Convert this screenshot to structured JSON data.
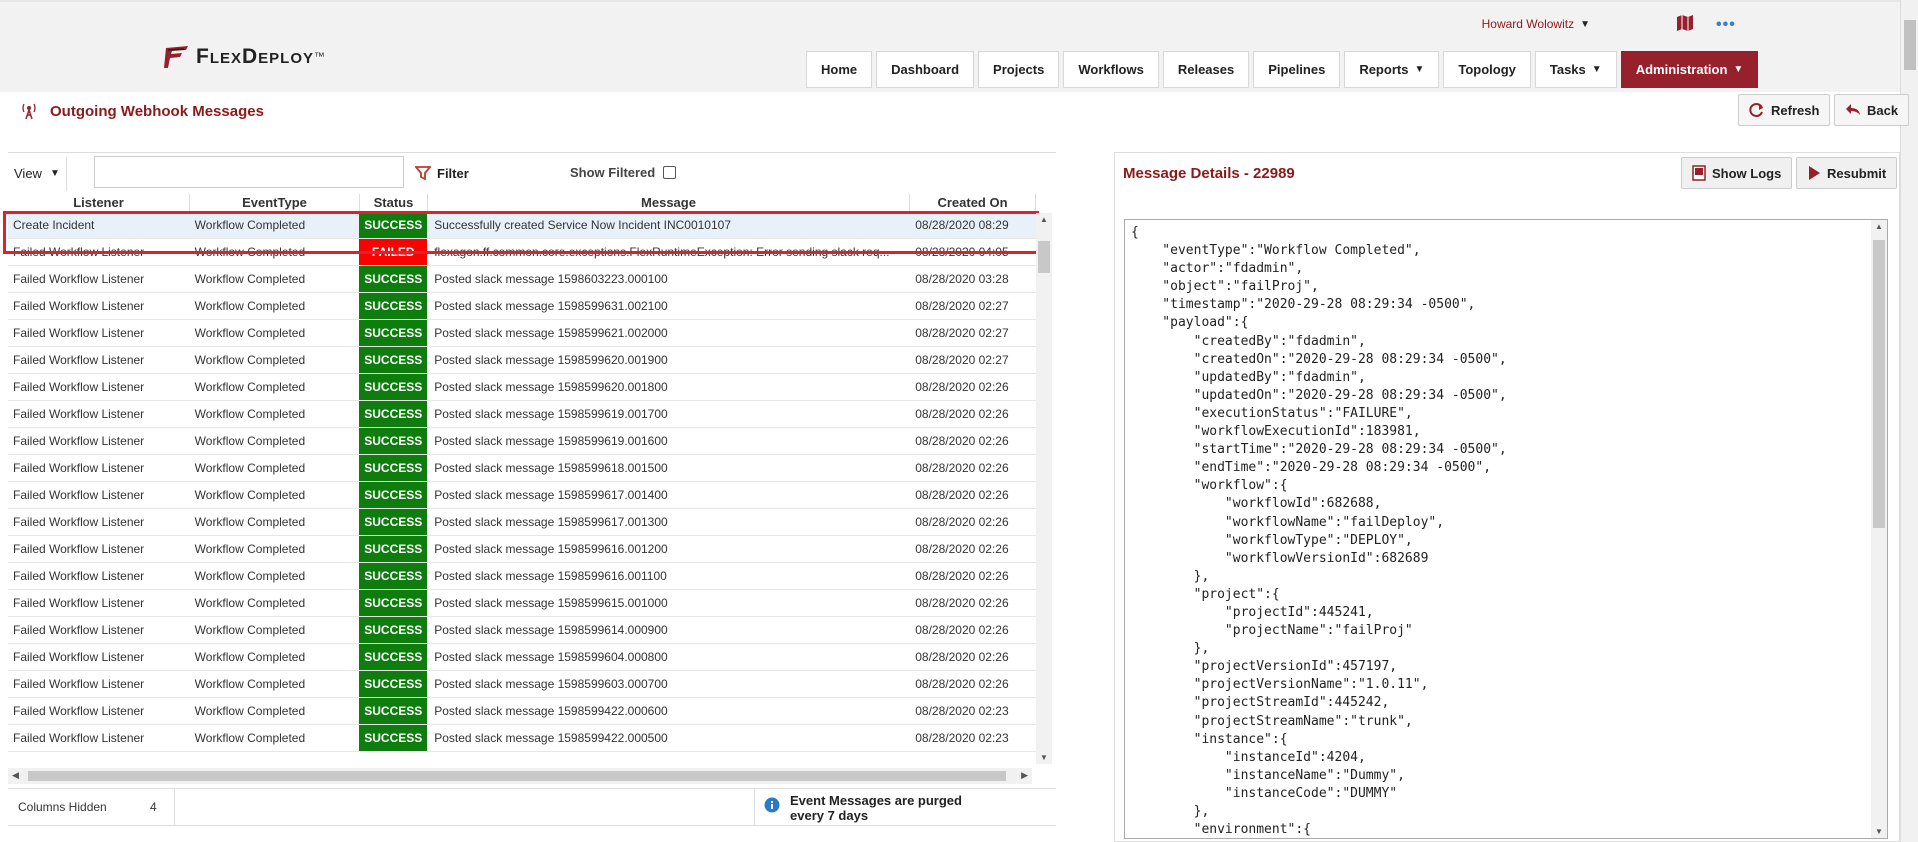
{
  "header": {
    "logo_text": "FlexDeploy",
    "logo_tm": "™",
    "user_name": "Howard Wolowitz",
    "more_dots": "•••",
    "nav": [
      {
        "label": "Home",
        "dropdown": false
      },
      {
        "label": "Dashboard",
        "dropdown": false
      },
      {
        "label": "Projects",
        "dropdown": false
      },
      {
        "label": "Workflows",
        "dropdown": false
      },
      {
        "label": "Releases",
        "dropdown": false
      },
      {
        "label": "Pipelines",
        "dropdown": false
      },
      {
        "label": "Reports",
        "dropdown": true
      },
      {
        "label": "Topology",
        "dropdown": false
      },
      {
        "label": "Tasks",
        "dropdown": true
      },
      {
        "label": "Administration",
        "dropdown": true,
        "active": true
      }
    ]
  },
  "page": {
    "title": "Outgoing Webhook Messages",
    "refresh_label": "Refresh",
    "back_label": "Back"
  },
  "toolbar": {
    "view_label": "View",
    "search_value": "",
    "filter_label": "Filter",
    "show_filtered_label": "Show Filtered",
    "show_filtered_checked": false
  },
  "table": {
    "columns": [
      "Listener",
      "EventType",
      "Status",
      "Message",
      "Created On"
    ],
    "rows": [
      {
        "listener": "Create Incident",
        "event": "Workflow Completed",
        "status": "SUCCESS",
        "message": "Successfully created Service Now Incident INC0010107",
        "created": "08/28/2020 08:29",
        "selected": true
      },
      {
        "listener": "Failed Workflow Listener",
        "event": "Workflow Completed",
        "status": "FAILED",
        "message": "flexagon.ff.common.core.exceptions.FlexRuntimeException: Error sending slack req...",
        "created": "08/28/2020 04:05"
      },
      {
        "listener": "Failed Workflow Listener",
        "event": "Workflow Completed",
        "status": "SUCCESS",
        "message": "Posted slack message 1598603223.000100",
        "created": "08/28/2020 03:28"
      },
      {
        "listener": "Failed Workflow Listener",
        "event": "Workflow Completed",
        "status": "SUCCESS",
        "message": "Posted slack message 1598599631.002100",
        "created": "08/28/2020 02:27"
      },
      {
        "listener": "Failed Workflow Listener",
        "event": "Workflow Completed",
        "status": "SUCCESS",
        "message": "Posted slack message 1598599621.002000",
        "created": "08/28/2020 02:27"
      },
      {
        "listener": "Failed Workflow Listener",
        "event": "Workflow Completed",
        "status": "SUCCESS",
        "message": "Posted slack message 1598599620.001900",
        "created": "08/28/2020 02:27"
      },
      {
        "listener": "Failed Workflow Listener",
        "event": "Workflow Completed",
        "status": "SUCCESS",
        "message": "Posted slack message 1598599620.001800",
        "created": "08/28/2020 02:26"
      },
      {
        "listener": "Failed Workflow Listener",
        "event": "Workflow Completed",
        "status": "SUCCESS",
        "message": "Posted slack message 1598599619.001700",
        "created": "08/28/2020 02:26"
      },
      {
        "listener": "Failed Workflow Listener",
        "event": "Workflow Completed",
        "status": "SUCCESS",
        "message": "Posted slack message 1598599619.001600",
        "created": "08/28/2020 02:26"
      },
      {
        "listener": "Failed Workflow Listener",
        "event": "Workflow Completed",
        "status": "SUCCESS",
        "message": "Posted slack message 1598599618.001500",
        "created": "08/28/2020 02:26"
      },
      {
        "listener": "Failed Workflow Listener",
        "event": "Workflow Completed",
        "status": "SUCCESS",
        "message": "Posted slack message 1598599617.001400",
        "created": "08/28/2020 02:26"
      },
      {
        "listener": "Failed Workflow Listener",
        "event": "Workflow Completed",
        "status": "SUCCESS",
        "message": "Posted slack message 1598599617.001300",
        "created": "08/28/2020 02:26"
      },
      {
        "listener": "Failed Workflow Listener",
        "event": "Workflow Completed",
        "status": "SUCCESS",
        "message": "Posted slack message 1598599616.001200",
        "created": "08/28/2020 02:26"
      },
      {
        "listener": "Failed Workflow Listener",
        "event": "Workflow Completed",
        "status": "SUCCESS",
        "message": "Posted slack message 1598599616.001100",
        "created": "08/28/2020 02:26"
      },
      {
        "listener": "Failed Workflow Listener",
        "event": "Workflow Completed",
        "status": "SUCCESS",
        "message": "Posted slack message 1598599615.001000",
        "created": "08/28/2020 02:26"
      },
      {
        "listener": "Failed Workflow Listener",
        "event": "Workflow Completed",
        "status": "SUCCESS",
        "message": "Posted slack message 1598599614.000900",
        "created": "08/28/2020 02:26"
      },
      {
        "listener": "Failed Workflow Listener",
        "event": "Workflow Completed",
        "status": "SUCCESS",
        "message": "Posted slack message 1598599604.000800",
        "created": "08/28/2020 02:26"
      },
      {
        "listener": "Failed Workflow Listener",
        "event": "Workflow Completed",
        "status": "SUCCESS",
        "message": "Posted slack message 1598599603.000700",
        "created": "08/28/2020 02:26"
      },
      {
        "listener": "Failed Workflow Listener",
        "event": "Workflow Completed",
        "status": "SUCCESS",
        "message": "Posted slack message 1598599422.000600",
        "created": "08/28/2020 02:23"
      },
      {
        "listener": "Failed Workflow Listener",
        "event": "Workflow Completed",
        "status": "SUCCESS",
        "message": "Posted slack message 1598599422.000500",
        "created": "08/28/2020 02:23"
      }
    ]
  },
  "footer": {
    "columns_hidden_label": "Columns Hidden",
    "columns_hidden_count": "4",
    "purge_notice": "Event Messages are purged every 7 days"
  },
  "details": {
    "title": "Message Details - 22989",
    "show_logs_label": "Show Logs",
    "resubmit_label": "Resubmit",
    "json_lines": [
      "{",
      "    \"eventType\":\"Workflow Completed\",",
      "    \"actor\":\"fdadmin\",",
      "    \"object\":\"failProj\",",
      "    \"timestamp\":\"2020-29-28 08:29:34 -0500\",",
      "    \"payload\":{",
      "        \"createdBy\":\"fdadmin\",",
      "        \"createdOn\":\"2020-29-28 08:29:34 -0500\",",
      "        \"updatedBy\":\"fdadmin\",",
      "        \"updatedOn\":\"2020-29-28 08:29:34 -0500\",",
      "        \"executionStatus\":\"FAILURE\",",
      "        \"workflowExecutionId\":183981,",
      "        \"startTime\":\"2020-29-28 08:29:34 -0500\",",
      "        \"endTime\":\"2020-29-28 08:29:34 -0500\",",
      "        \"workflow\":{",
      "            \"workflowId\":682688,",
      "            \"workflowName\":\"failDeploy\",",
      "            \"workflowType\":\"DEPLOY\",",
      "            \"workflowVersionId\":682689",
      "        },",
      "        \"project\":{",
      "            \"projectId\":445241,",
      "            \"projectName\":\"failProj\"",
      "        },",
      "        \"projectVersionId\":457197,",
      "        \"projectVersionName\":\"1.0.11\",",
      "        \"projectStreamId\":445242,",
      "        \"projectStreamName\":\"trunk\",",
      "        \"instance\":{",
      "            \"instanceId\":4204,",
      "            \"instanceName\":\"Dummy\",",
      "            \"instanceCode\":\"DUMMY\"",
      "        },",
      "        \"environment\":{"
    ]
  },
  "colors": {
    "brand": "#96202b",
    "title": "#8b1a1a",
    "success": "#0e7d0e",
    "failed": "#ff0000",
    "highlight": "#e0202a"
  }
}
